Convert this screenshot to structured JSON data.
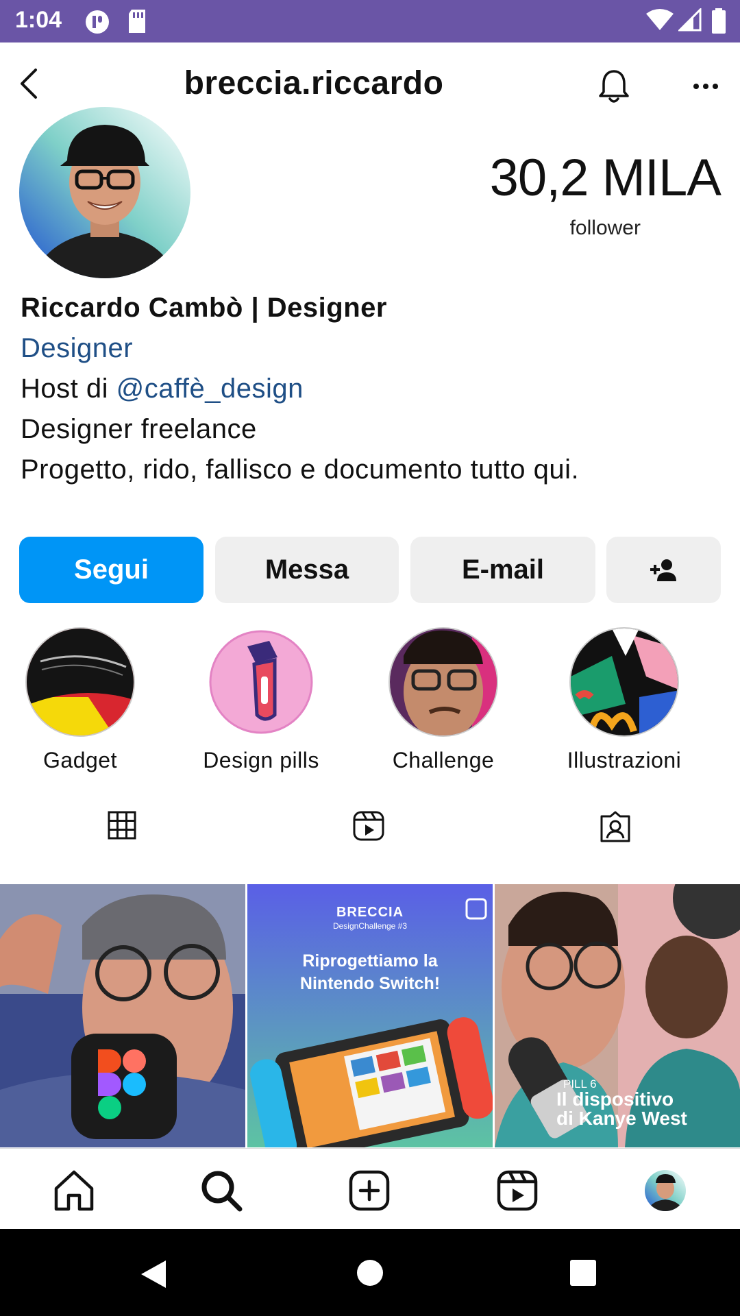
{
  "status_bar": {
    "time": "1:04"
  },
  "header": {
    "username": "breccia.riccardo"
  },
  "profile": {
    "followers_count": "30,2 MILA",
    "followers_label": "follower",
    "name": "Riccardo Cambò | Designer",
    "category": "Designer",
    "bio_host_prefix": "Host di ",
    "bio_host_mention": "@caffè_design",
    "bio_line2": "Designer freelance",
    "bio_line3": "Progetto, rido, fallisco e documento tutto qui."
  },
  "actions": {
    "follow": "Segui",
    "message": "Messa",
    "email": "E-mail"
  },
  "highlights": [
    {
      "label": "Gadget"
    },
    {
      "label": "Design pills"
    },
    {
      "label": "Challenge"
    },
    {
      "label": "Illustrazioni"
    }
  ],
  "posts": [
    {
      "kind": "figma-photo"
    },
    {
      "brand": "BRECCIA",
      "subtitle": "DesignChallenge #3",
      "headline_1": "Riprogettiamo la",
      "headline_2": "Nintendo Switch!"
    },
    {
      "tag": "PILL 6",
      "headline_1": "Il dispositivo",
      "headline_2": "di Kanye West"
    }
  ],
  "colors": {
    "status_bar": "#6a55a6",
    "follow_button": "#0095f6",
    "link": "#1f4f86"
  }
}
